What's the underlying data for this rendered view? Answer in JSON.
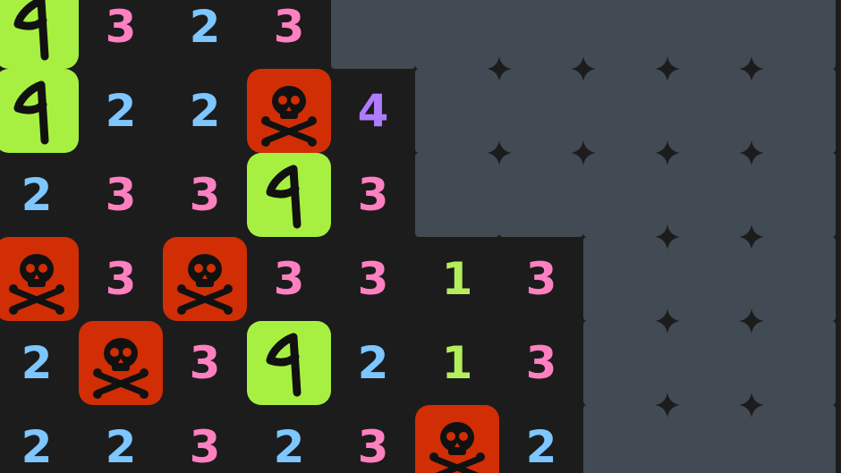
{
  "game": {
    "name": "minesweeper",
    "rows_visible": 6,
    "cols_visible": 10,
    "grid": [
      [
        "F",
        "3",
        "2",
        "3",
        "H",
        "H",
        "H",
        "H",
        "H",
        "H"
      ],
      [
        "F",
        "2",
        "2",
        "M",
        "4",
        "H",
        "H",
        "H",
        "H",
        "H"
      ],
      [
        "2",
        "3",
        "3",
        "F",
        "3",
        "H",
        "H",
        "H",
        "H",
        "H"
      ],
      [
        "M",
        "3",
        "M",
        "3",
        "3",
        "1",
        "3",
        "H",
        "H",
        "H"
      ],
      [
        "2",
        "M",
        "3",
        "F",
        "2",
        "1",
        "3",
        "H",
        "H",
        "H"
      ],
      [
        "2",
        "2",
        "3",
        "2",
        "3",
        "M",
        "2",
        "H",
        "H",
        "H"
      ]
    ],
    "legend": {
      "F": "flag",
      "M": "mine",
      "H": "hidden"
    }
  },
  "colors": {
    "background": "#1c1c1c",
    "hidden_tile": "#424b53",
    "flag_tile": "#a7f042",
    "mine_tile": "#d12e05",
    "num_1": "#b4ee5c",
    "num_2": "#7ec6ff",
    "num_3": "#ff80c0",
    "num_4": "#b07cff"
  },
  "icons": {
    "flag": "flag-icon",
    "mine": "skull-crossbones-icon",
    "hidden_gap": "sparkle-star"
  }
}
